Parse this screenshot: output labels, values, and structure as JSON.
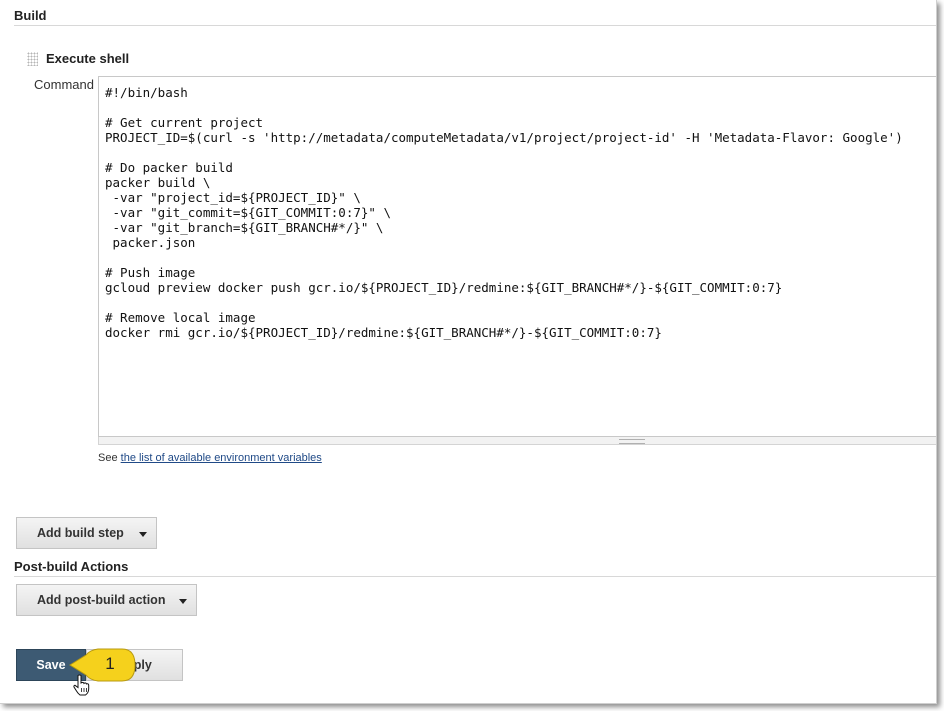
{
  "build": {
    "header": "Build",
    "step": {
      "title": "Execute shell",
      "command_label": "Command",
      "command_lines": [
        "#!/bin/bash",
        "",
        "# Get current project",
        "PROJECT_ID=$(curl -s 'http://metadata/computeMetadata/v1/project/project-id' -H 'Metadata-Flavor: Google')",
        "",
        "# Do packer build",
        "packer build \\",
        " -var \"project_id=${PROJECT_ID}\" \\",
        " -var \"git_commit=${GIT_COMMIT:0:7}\" \\",
        " -var \"git_branch=${GIT_BRANCH#*/}\" \\",
        " packer.json",
        "",
        "# Push image",
        "gcloud preview docker push gcr.io/${PROJECT_ID}/redmine:${GIT_BRANCH#*/}-${GIT_COMMIT:0:7}",
        "",
        "# Remove local image",
        "docker rmi gcr.io/${PROJECT_ID}/redmine:${GIT_BRANCH#*/}-${GIT_COMMIT:0:7}"
      ],
      "env_note_prefix": "See",
      "env_link": "the list of available environment variables"
    },
    "add_step_label": "Add build step"
  },
  "post_build": {
    "header": "Post-build Actions",
    "add_action_label": "Add post-build action"
  },
  "footer": {
    "save_label": "Save",
    "apply_label": "Apply",
    "callout_number": "1"
  },
  "colors": {
    "save_bg": "#3d5a73",
    "callout_fill": "#f5d11c",
    "link": "#204a87"
  }
}
